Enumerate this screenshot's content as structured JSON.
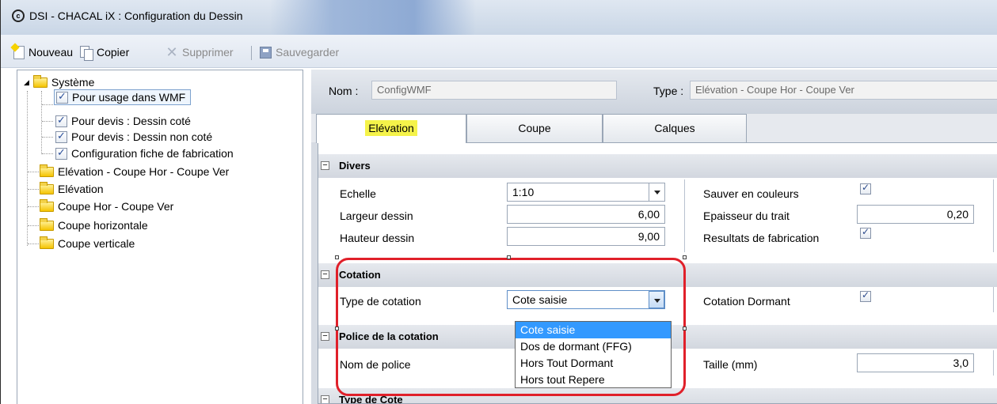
{
  "window": {
    "title": "DSI - CHACAL iX : Configuration du Dessin",
    "app_icon": "copyright-icon"
  },
  "toolbar": {
    "new_label": "Nouveau",
    "copy_label": "Copier",
    "delete_label": "Supprimer",
    "save_label": "Sauvegarder"
  },
  "tree": {
    "root": "Système",
    "children": [
      "Pour usage dans WMF",
      "Pour devis : Dessin coté",
      "Pour devis : Dessin non coté",
      "Configuration fiche de fabrication"
    ],
    "items": [
      "Elévation - Coupe Hor - Coupe Ver",
      "Elévation",
      "Coupe Hor - Coupe Ver",
      "Coupe horizontale",
      "Coupe verticale"
    ]
  },
  "header": {
    "name_label": "Nom :",
    "name_value": "ConfigWMF",
    "type_label": "Type :",
    "type_value": "Elévation - Coupe Hor - Coupe Ver"
  },
  "tabs": [
    "Elévation",
    "Coupe",
    "Calques"
  ],
  "sections": {
    "divers": "Divers",
    "cotation": "Cotation",
    "police": "Police de la cotation",
    "type_cote": "Type de Cote"
  },
  "divers": {
    "echelle_label": "Echelle",
    "echelle_value": "1:10",
    "largeur_label": "Largeur dessin",
    "largeur_value": "6,00",
    "hauteur_label": "Hauteur dessin",
    "hauteur_value": "9,00",
    "couleurs_label": "Sauver en couleurs",
    "epaisseur_label": "Epaisseur du trait",
    "epaisseur_value": "0,20",
    "resultats_label": "Resultats de fabrication"
  },
  "cotation": {
    "type_label": "Type de cotation",
    "type_value": "Cote saisie",
    "dormant_label": "Cotation Dormant",
    "options": [
      "Cote saisie",
      "Dos de dormant (FFG)",
      "Hors Tout Dormant",
      "Hors tout Repere"
    ]
  },
  "police": {
    "nom_label": "Nom de police",
    "taille_label": "Taille (mm)",
    "taille_value": "3,0"
  }
}
